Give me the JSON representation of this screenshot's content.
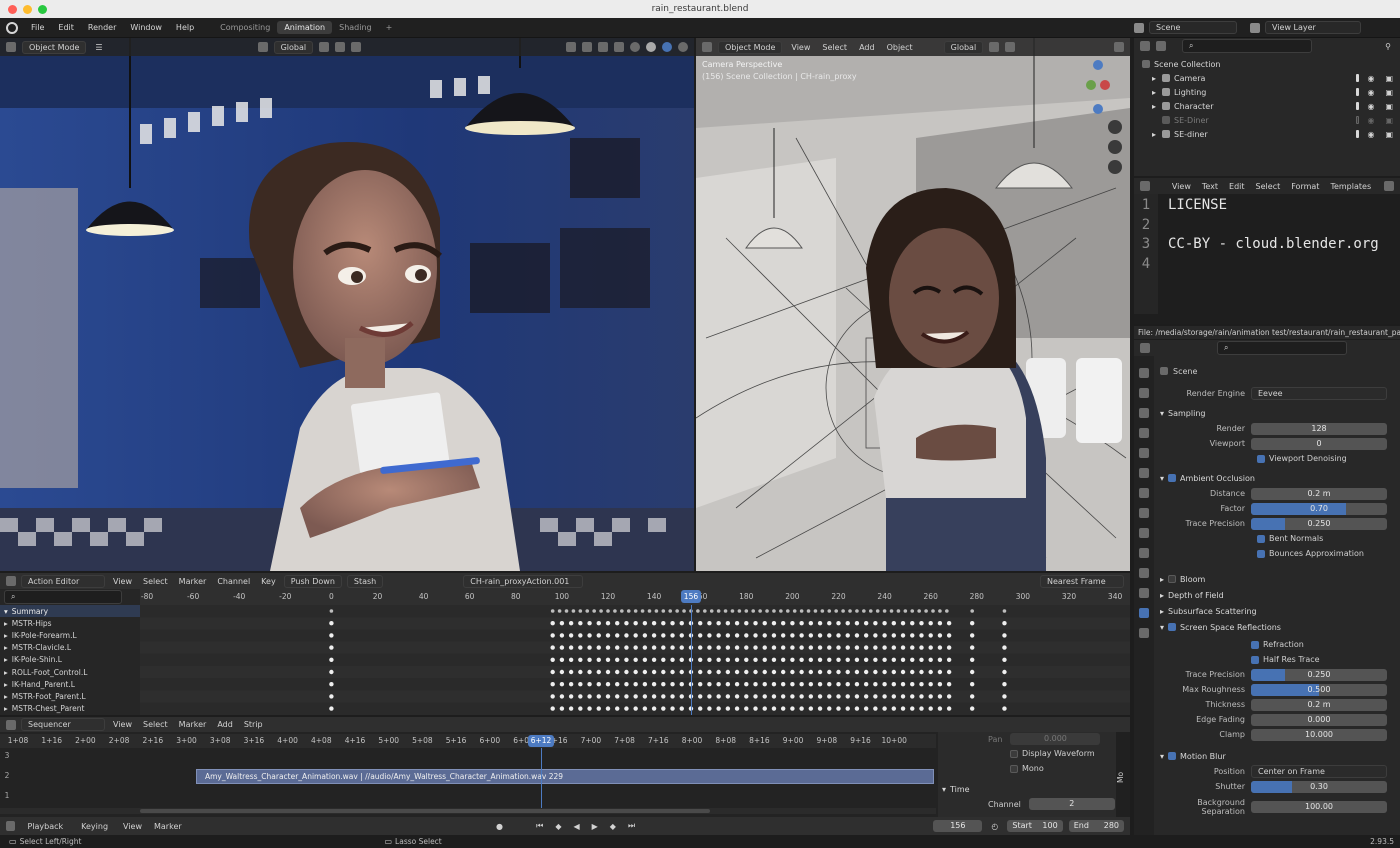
{
  "window_title": "rain_restaurant.blend",
  "menu": [
    "File",
    "Edit",
    "Render",
    "Window",
    "Help"
  ],
  "workspaces": [
    "Compositing",
    "Animation",
    "Shading",
    "+"
  ],
  "active_workspace": "Animation",
  "scene_selector": "Scene",
  "view_layer_selector": "View Layer",
  "left_viewport": {
    "mode": "Object Mode",
    "transform": "Global"
  },
  "right_viewport": {
    "mode": "Object Mode",
    "menus": [
      "View",
      "Select",
      "Add",
      "Object"
    ],
    "transform": "Global",
    "overlay_title": "Camera Perspective",
    "overlay_subtitle": "(156) Scene Collection | CH-rain_proxy"
  },
  "outliner": {
    "root": "Scene Collection",
    "items": [
      {
        "label": "Camera",
        "dim": false
      },
      {
        "label": "Lighting",
        "dim": false
      },
      {
        "label": "Character",
        "dim": false
      },
      {
        "label": "SE-Diner",
        "dim": true
      },
      {
        "label": "SE-diner",
        "dim": false
      }
    ]
  },
  "text_editor": {
    "menus": [
      "View",
      "Text",
      "Edit",
      "Select",
      "Format",
      "Templates"
    ],
    "line_numbers": [
      "1",
      "2",
      "3",
      "4"
    ],
    "lines": [
      "LICENSE",
      "",
      "CC-BY - cloud.blender.org",
      ""
    ],
    "file_path": "File: /media/storage/rain/animation test/restaurant/rain_restaurant_pack"
  },
  "properties": {
    "context": "Scene",
    "render_engine_label": "Render Engine",
    "render_engine": "Eevee",
    "sampling": {
      "title": "Sampling",
      "render_label": "Render",
      "render": "128",
      "viewport_label": "Viewport",
      "viewport": "0",
      "denoise": "Viewport Denoising"
    },
    "ao": {
      "title": "Ambient Occlusion",
      "distance_label": "Distance",
      "distance": "0.2 m",
      "factor_label": "Factor",
      "factor": "0.70",
      "factor_level": 0.7,
      "trace_label": "Trace Precision",
      "trace": "0.250",
      "trace_level": 0.25,
      "bent": "Bent Normals",
      "bounces": "Bounces Approximation"
    },
    "collapsed": [
      "Bloom",
      "Depth of Field",
      "Subsurface Scattering"
    ],
    "ssr": {
      "title": "Screen Space Reflections",
      "refraction": "Refraction",
      "half_res": "Half Res Trace",
      "trace_label": "Trace Precision",
      "trace": "0.250",
      "trace_level": 0.25,
      "rough_label": "Max Roughness",
      "rough": "0.500",
      "rough_level": 0.5,
      "thick_label": "Thickness",
      "thick": "0.2 m",
      "edge_label": "Edge Fading",
      "edge": "0.000",
      "clamp_label": "Clamp",
      "clamp": "10.000"
    },
    "motion_blur": {
      "title": "Motion Blur",
      "position_label": "Position",
      "position": "Center on Frame",
      "shutter_label": "Shutter",
      "shutter": "0.30",
      "shutter_level": 0.3,
      "bg_label": "Background Separation",
      "bg": "100.00"
    }
  },
  "dopesheet": {
    "mode": "Action Editor",
    "menus": [
      "View",
      "Select",
      "Marker",
      "Channel",
      "Key"
    ],
    "push_down": "Push Down",
    "stash": "Stash",
    "action": "CH-rain_proxyAction.001",
    "snap": "Nearest Frame",
    "ruler": [
      "-80",
      "-60",
      "-40",
      "-20",
      "0",
      "20",
      "40",
      "60",
      "80",
      "100",
      "120",
      "140",
      "160",
      "180",
      "200",
      "220",
      "240",
      "260",
      "280",
      "300",
      "320",
      "340"
    ],
    "current_frame": "156",
    "channels": [
      "Summary",
      "MSTR-Hips",
      "IK-Pole-Forearm.L",
      "MSTR-Clavicle.L",
      "IK-Pole-Shin.L",
      "ROLL-Foot_Control.L",
      "IK-Hand_Parent.L",
      "MSTR-Foot_Parent.L",
      "MSTR-Chest_Parent"
    ]
  },
  "sequencer": {
    "mode": "Sequencer",
    "menus": [
      "View",
      "Select",
      "Marker",
      "Add",
      "Strip"
    ],
    "ruler": [
      "1+08",
      "1+16",
      "2+00",
      "2+08",
      "2+16",
      "3+00",
      "3+08",
      "3+16",
      "4+00",
      "4+08",
      "4+16",
      "5+00",
      "5+08",
      "5+16",
      "6+00",
      "6+08",
      "6+16",
      "7+00",
      "7+08",
      "7+16",
      "8+00",
      "8+08",
      "8+16",
      "9+00",
      "9+08",
      "9+16",
      "10+00"
    ],
    "current_time": "6+12",
    "channels": [
      "3",
      "2",
      "1"
    ],
    "strip_label": "Amy_Waltress_Character_Animation.wav | //audio/Amy_Waltress_Character_Animation.wav   229",
    "pan_label": "Pan",
    "pan": "0.000",
    "display_waveform": "Display Waveform",
    "mono": "Mono",
    "time_section": "Time",
    "channel_label": "Channel",
    "channel": "2",
    "side_tab": "Mo"
  },
  "timeline": {
    "menus": [
      "Playback",
      "Keying",
      "View",
      "Marker"
    ],
    "frame": "156",
    "start_label": "Start",
    "start": "100",
    "end_label": "End",
    "end": "280"
  },
  "statusbar": {
    "left": "Select Left/Right",
    "middle": "Lasso Select",
    "version": "2.93.5"
  },
  "colors": {
    "accent": "#4772b3",
    "current_frame": "#4d7bc2",
    "strip": "#5b6b95"
  }
}
